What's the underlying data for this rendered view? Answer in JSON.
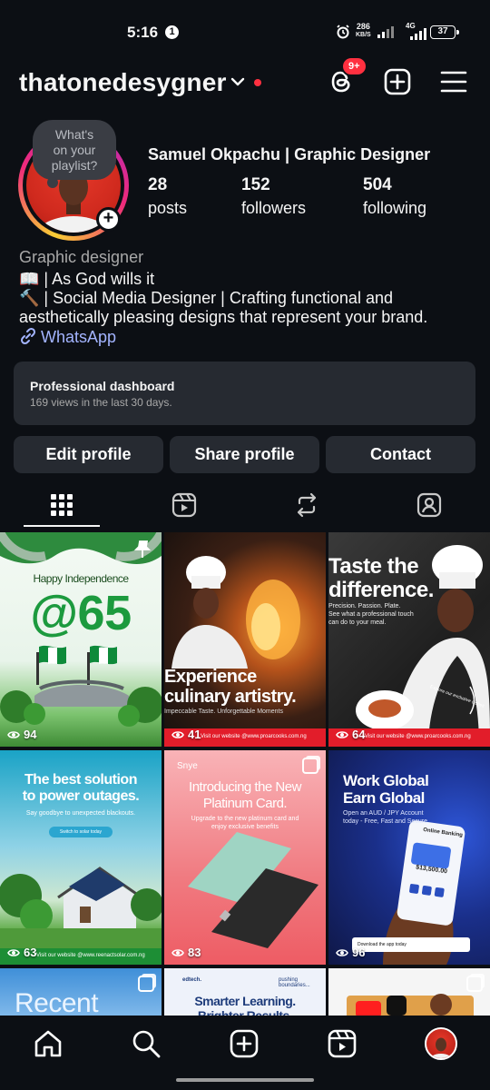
{
  "status_bar": {
    "time": "5:16",
    "notif_count": "1",
    "speed_top": "286",
    "speed_unit": "KB/S",
    "network": "4G",
    "battery": "37"
  },
  "header": {
    "username": "thatonedesygner",
    "threads_badge": "9+"
  },
  "note": {
    "line1": "What's",
    "line2": "on your",
    "line3": "playlist?"
  },
  "profile": {
    "full_name": "Samuel Okpachu | Graphic Designer",
    "stats": [
      {
        "value": "28",
        "label": "posts"
      },
      {
        "value": "152",
        "label": "followers"
      },
      {
        "value": "504",
        "label": "following"
      }
    ],
    "category": "Graphic designer",
    "bio": [
      "📖 | As God wills it",
      "🔨 | Social Media Designer | Crafting functional and",
      "aesthetically pleasing designs that represent your brand."
    ],
    "link": "WhatsApp"
  },
  "dashboard": {
    "title": "Professional dashboard",
    "subtitle": "169 views in the last 30 days."
  },
  "buttons": {
    "edit": "Edit profile",
    "share": "Share profile",
    "contact": "Contact"
  },
  "posts": [
    {
      "views": "94",
      "title1": "Happy Independence",
      "title2": "@65"
    },
    {
      "views": "41",
      "title1": "Experience",
      "title2": "culinary artistry.",
      "sub": "Impeccable Taste. Unforgettable Moments",
      "footer": "Visit our website @www.proarcooks.com.ng"
    },
    {
      "views": "64",
      "title1": "Taste the",
      "title2": "difference.",
      "sub": "Precision. Passion. Plate.",
      "sub2": "See what a professional touch",
      "sub3": "can do to your meal.",
      "cta": "Explore our exclusive dishes",
      "footer": "Visit our website @www.proarcooks.com.ng"
    },
    {
      "views": "63",
      "title1": "The best solution",
      "title2": "to power outages.",
      "sub": "Say goodbye to unexpected blackouts.",
      "cta": "Switch to solar today",
      "footer": "Visit our website @www.reenactsolar.com.ng"
    },
    {
      "views": "83",
      "brand": "Snye",
      "title1": "Introducing the New",
      "title2": "Platinum Card.",
      "sub": "Upgrade to the new platinum card and",
      "sub2": "enjoy exclusive benefits"
    },
    {
      "views": "96",
      "title1": "Work Global",
      "title2": "Earn Global",
      "sub": "Open an AUD / JPY Account",
      "sub2": "today - Free, Fast and Secure.",
      "phone_title": "Online Banking",
      "phone_amount": "$13,500.00",
      "cta": "Download the app today"
    },
    {
      "title1": "Recent"
    },
    {
      "brand": "edtech.",
      "tag": "pushing boundaries...",
      "title1": "Smarter Learning.",
      "title2": "Brighter Results."
    },
    {}
  ]
}
